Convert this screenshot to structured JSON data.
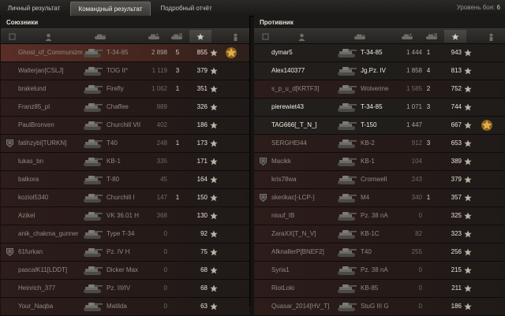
{
  "tabs": [
    {
      "label": "Личный результат",
      "active": false
    },
    {
      "label": "Командный результат",
      "active": true
    },
    {
      "label": "Подробный отчёт",
      "active": false
    }
  ],
  "battle_level": {
    "label": "Уровень боя:",
    "value": "6"
  },
  "allies": {
    "title": "Союзники",
    "rows": [
      {
        "name": "Ghost_of_Communizm",
        "tank": "T-34-85",
        "damage": "2 898",
        "frags": "5",
        "xp": "855",
        "self": true,
        "alive": false,
        "platoon": false,
        "medal": true
      },
      {
        "name": "Walterjan[CSLJ]",
        "tank": "TOG II*",
        "damage": "1 119",
        "frags": "3",
        "xp": "379",
        "alive": false,
        "platoon": false
      },
      {
        "name": "brakelund",
        "tank": "Firefly",
        "damage": "1 062",
        "frags": "1",
        "xp": "351",
        "alive": false,
        "platoon": false
      },
      {
        "name": "Franz85_pl",
        "tank": "Chaffee",
        "damage": "989",
        "frags": "",
        "xp": "326",
        "alive": false,
        "platoon": false
      },
      {
        "name": "PaulBronven",
        "tank": "Churchill VII",
        "damage": "402",
        "frags": "",
        "xp": "186",
        "alive": false,
        "platoon": false
      },
      {
        "name": "fatihzybi[TURKN]",
        "tank": "T40",
        "damage": "248",
        "frags": "1",
        "xp": "173",
        "alive": false,
        "platoon": true
      },
      {
        "name": "lukas_bn",
        "tank": "KB-1",
        "damage": "335",
        "frags": "",
        "xp": "171",
        "alive": false,
        "platoon": false
      },
      {
        "name": "balkora",
        "tank": "T-80",
        "damage": "45",
        "frags": "",
        "xp": "164",
        "alive": false,
        "platoon": false
      },
      {
        "name": "koziol5340",
        "tank": "Churchill I",
        "damage": "147",
        "frags": "1",
        "xp": "150",
        "alive": false,
        "platoon": false
      },
      {
        "name": "Azikel",
        "tank": "VK 36.01 H",
        "damage": "368",
        "frags": "",
        "xp": "130",
        "alive": false,
        "platoon": false
      },
      {
        "name": "anik_chakma_gunner",
        "tank": "Type T-34",
        "damage": "0",
        "frags": "",
        "xp": "92",
        "alive": false,
        "platoon": false
      },
      {
        "name": "61furkan",
        "tank": "Pz. IV H",
        "damage": "0",
        "frags": "",
        "xp": "75",
        "alive": false,
        "platoon": true
      },
      {
        "name": "pascalK11[LDDT]",
        "tank": "Dicker Max",
        "damage": "0",
        "frags": "",
        "xp": "68",
        "alive": false,
        "platoon": false
      },
      {
        "name": "Heinrich_377",
        "tank": "Pz. III/IV",
        "damage": "0",
        "frags": "",
        "xp": "68",
        "alive": false,
        "platoon": false
      },
      {
        "name": "Your_Naqba",
        "tank": "Matilda",
        "damage": "0",
        "frags": "",
        "xp": "63",
        "alive": false,
        "platoon": false
      }
    ]
  },
  "enemies": {
    "title": "Противник",
    "rows": [
      {
        "name": "dymar5",
        "tank": "T-34-85",
        "damage": "1 444",
        "frags": "1",
        "xp": "943",
        "alive": true,
        "platoon": false
      },
      {
        "name": "Alex140377",
        "tank": "Jg.Pz. IV",
        "damage": "1 858",
        "frags": "4",
        "xp": "813",
        "alive": true,
        "platoon": false
      },
      {
        "name": "s_p_u_d[KRTF3]",
        "tank": "Wolverine",
        "damage": "1 585",
        "frags": "2",
        "xp": "752",
        "alive": false,
        "platoon": false
      },
      {
        "name": "pierewiet43",
        "tank": "T-34-85",
        "damage": "1 071",
        "frags": "3",
        "xp": "744",
        "alive": true,
        "platoon": false
      },
      {
        "name": "TAG666[_T_N_]",
        "tank": "T-150",
        "damage": "1 447",
        "frags": "",
        "xp": "667",
        "alive": true,
        "platoon": false,
        "medal": true
      },
      {
        "name": "SERGHEI44",
        "tank": "KB-2",
        "damage": "912",
        "frags": "3",
        "xp": "653",
        "alive": false,
        "platoon": false
      },
      {
        "name": "Macikk",
        "tank": "KB-1",
        "damage": "104",
        "frags": "",
        "xp": "389",
        "alive": false,
        "platoon": true
      },
      {
        "name": "kris78wa",
        "tank": "Cromwell",
        "damage": "243",
        "frags": "",
        "xp": "379",
        "alive": false,
        "platoon": false
      },
      {
        "name": "skerikac[-LCP-]",
        "tank": "M4",
        "damage": "340",
        "frags": "1",
        "xp": "357",
        "alive": false,
        "platoon": true
      },
      {
        "name": "niouf_IB",
        "tank": "Pz. 38 nA",
        "damage": "0",
        "frags": "",
        "xp": "325",
        "alive": false,
        "platoon": false
      },
      {
        "name": "ZaraXX[T_N_V]",
        "tank": "KB-1C",
        "damage": "82",
        "frags": "",
        "xp": "323",
        "alive": false,
        "platoon": false
      },
      {
        "name": "AfknallerP[BNEF2]",
        "tank": "T40",
        "damage": "255",
        "frags": "",
        "xp": "256",
        "alive": false,
        "platoon": false
      },
      {
        "name": "Syria1",
        "tank": "Pz. 38 nA",
        "damage": "0",
        "frags": "",
        "xp": "215",
        "alive": false,
        "platoon": false
      },
      {
        "name": "RiotLoki",
        "tank": "KB-85",
        "damage": "0",
        "frags": "",
        "xp": "211",
        "alive": false,
        "platoon": false
      },
      {
        "name": "Quasar_2014[HV_T]",
        "tank": "StuG III G",
        "damage": "0",
        "frags": "",
        "xp": "186",
        "alive": false,
        "platoon": false
      }
    ]
  },
  "colors": {
    "accent_star": "#e2b04a",
    "self_row": "#5a2e26",
    "alive_text": "#f3eee2",
    "dead_text": "#8f8a80"
  }
}
